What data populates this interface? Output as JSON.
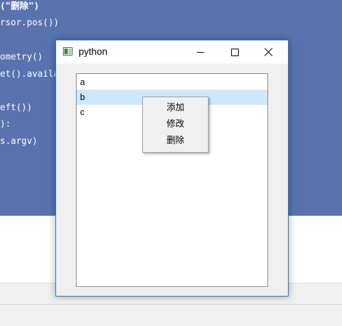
{
  "editor": {
    "code_lines": [
      "(\"删除\")",
      "rsor.pos())",
      "ometry()",
      "et().availa",
      "eft())",
      "):",
      "s.argv)"
    ]
  },
  "window": {
    "title": "python",
    "icon": "python-app-icon",
    "controls": [
      "minimize-icon",
      "maximize-icon",
      "close-icon"
    ]
  },
  "list": {
    "items": [
      "a",
      "b",
      "c"
    ],
    "selected_index": 1
  },
  "context_menu": {
    "items": [
      "添加",
      "修改",
      "删除"
    ]
  },
  "colors": {
    "editor_background": "#5873ad",
    "selection": "#cce8ff",
    "window_border": "#1e7ad6"
  }
}
